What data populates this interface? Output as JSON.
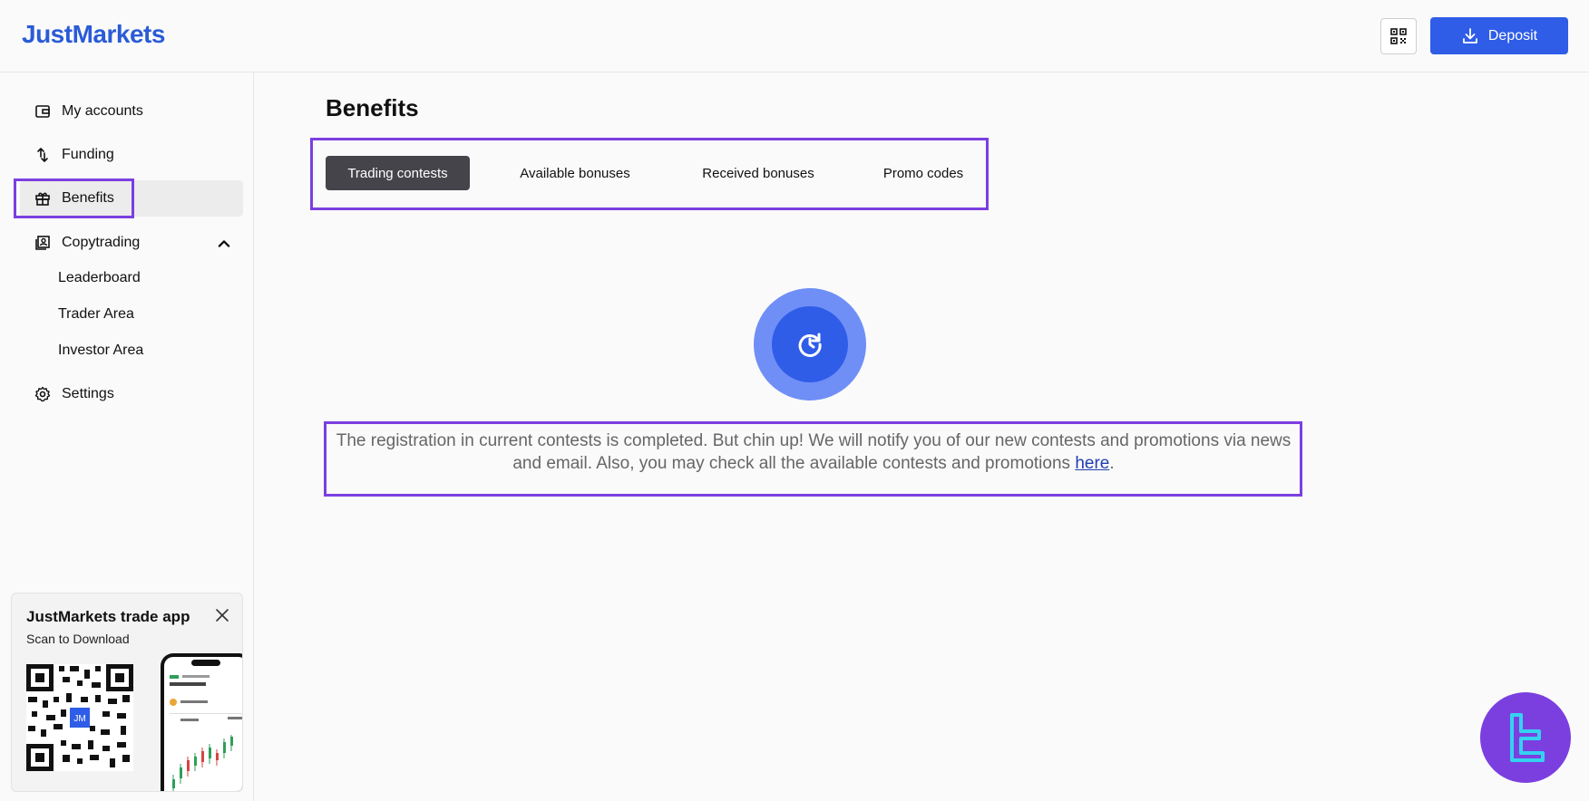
{
  "header": {
    "logo": "JustMarkets",
    "qr_icon": "qr-code-icon",
    "deposit_label": "Deposit",
    "deposit_icon": "download-icon"
  },
  "sidebar": {
    "items": [
      {
        "label": "My accounts",
        "icon": "wallet-icon"
      },
      {
        "label": "Funding",
        "icon": "arrows-exchange-icon"
      },
      {
        "label": "Benefits",
        "icon": "gift-icon"
      },
      {
        "label": "Copytrading",
        "icon": "copytrading-icon"
      },
      {
        "label": "Settings",
        "icon": "gear-icon"
      }
    ],
    "copytrading_sub": [
      "Leaderboard",
      "Trader Area",
      "Investor Area"
    ],
    "active": "Benefits"
  },
  "promo": {
    "title": "JustMarkets trade app",
    "subtitle": "Scan to Download",
    "qr_badge": "JM"
  },
  "main": {
    "title": "Benefits",
    "tabs": [
      "Trading contests",
      "Available bonuses",
      "Received bonuses",
      "Promo codes"
    ],
    "active_tab": "Trading contests",
    "message_text": "The registration in current contests is completed. But chin up! We will notify you of our new contests and promotions via news and email. Also, you may check all the available contests and promotions ",
    "message_link": "here",
    "message_end": "."
  },
  "colors": {
    "brand_blue": "#2f5de8",
    "highlight_purple": "#7b3fe0",
    "active_tab": "#45444a"
  }
}
